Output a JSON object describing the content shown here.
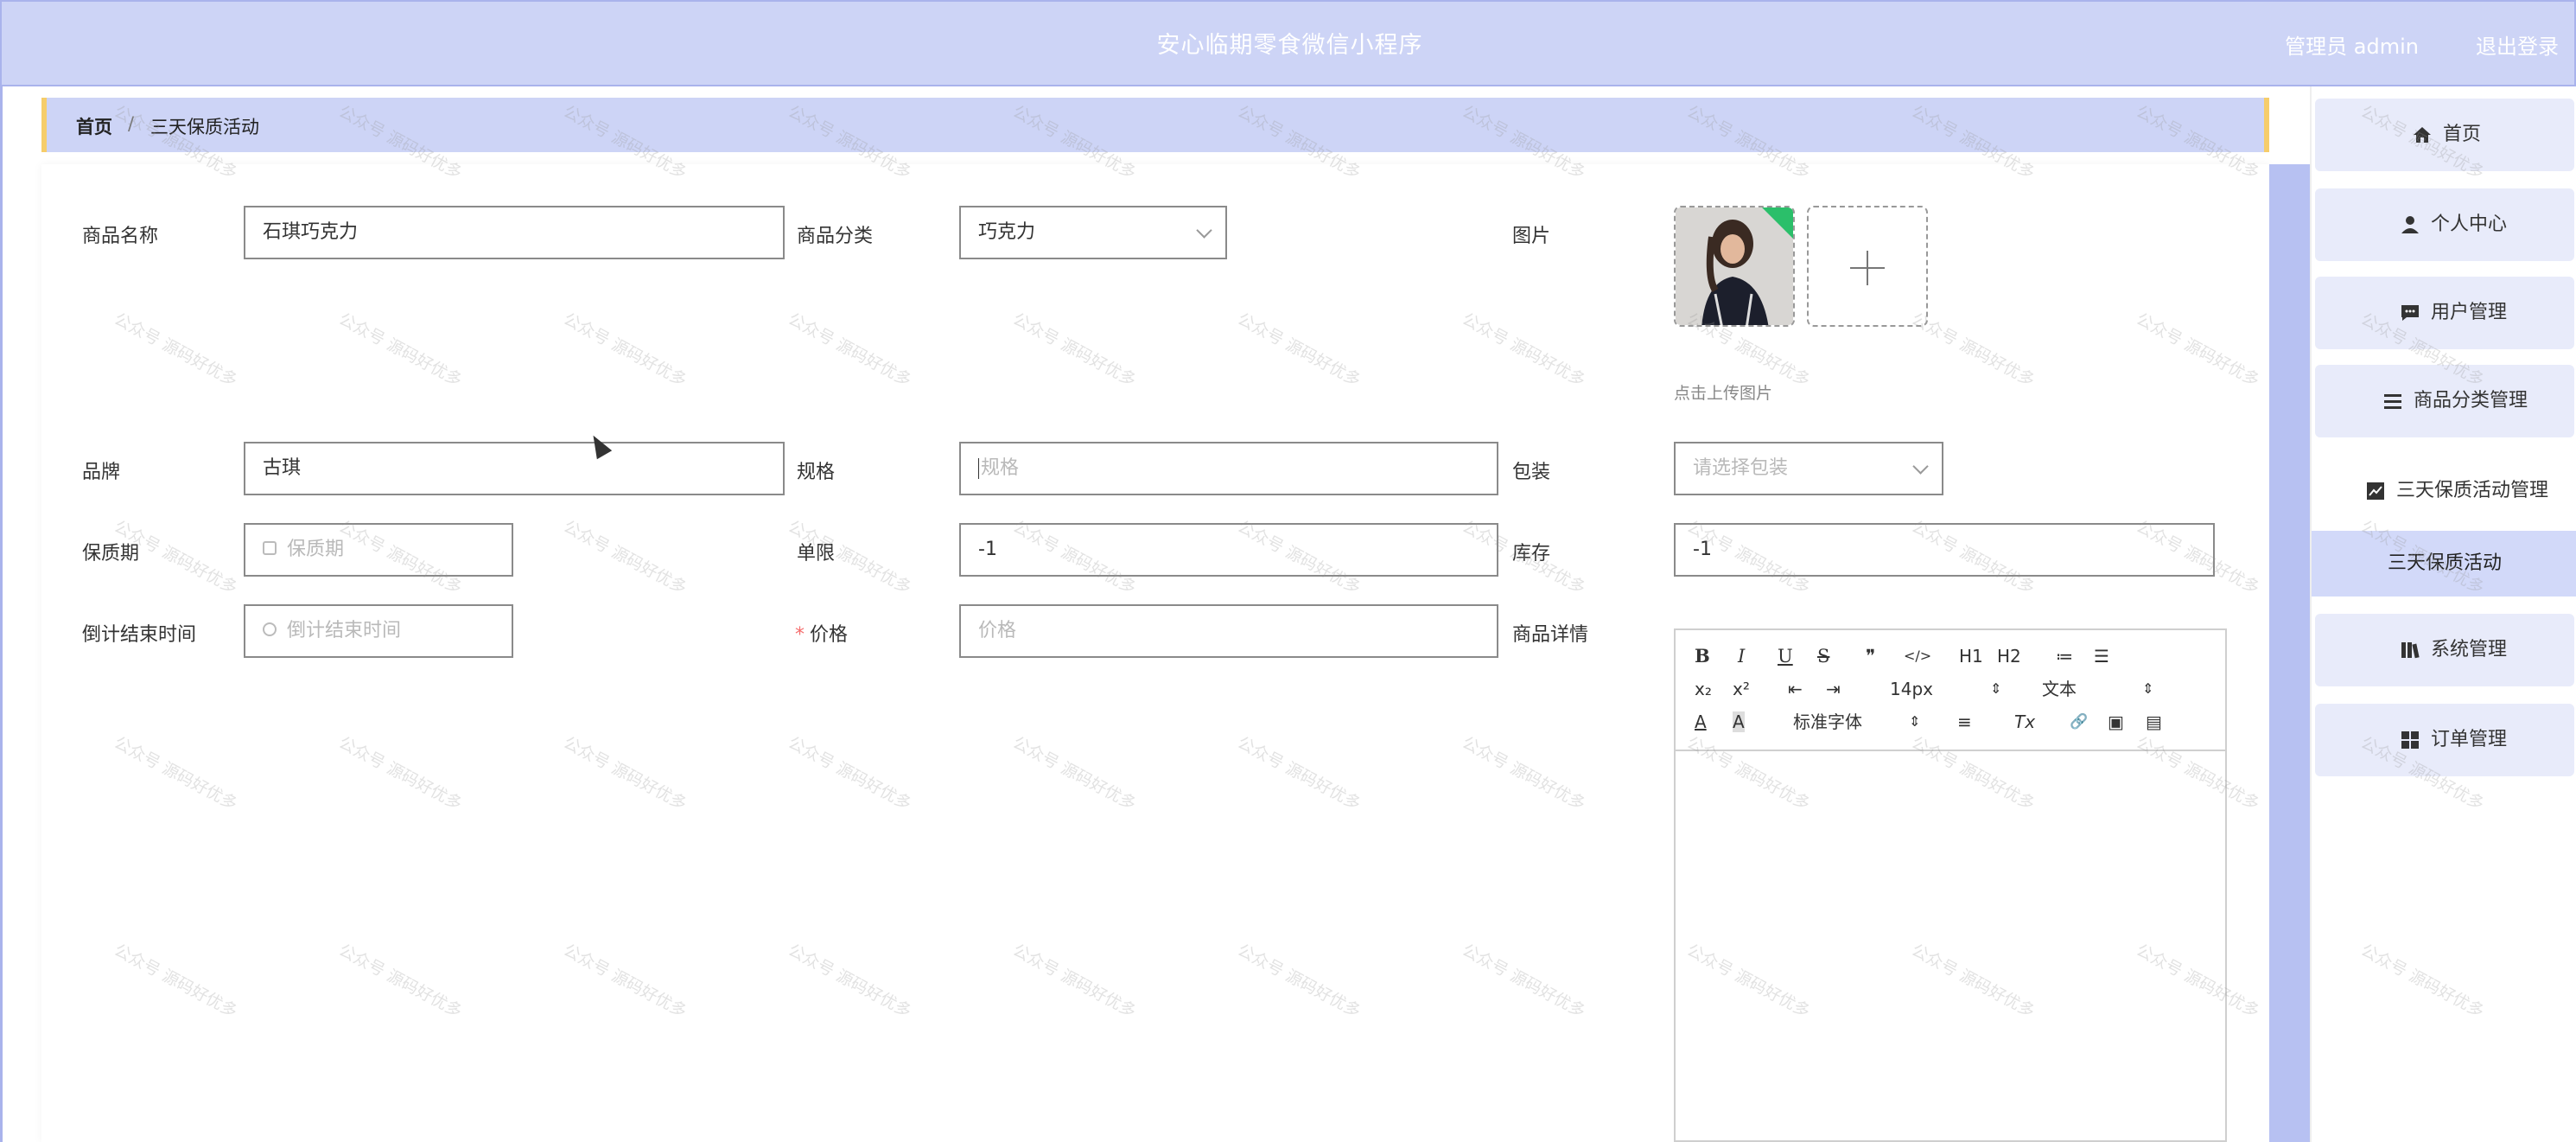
{
  "header": {
    "title": "安心临期零食微信小程序",
    "user_label": "管理员 admin",
    "logout_label": "退出登录"
  },
  "breadcrumb": {
    "home": "首页",
    "separator": "/",
    "current": "三天保质活动"
  },
  "sidebar": {
    "items": [
      {
        "label": "首页",
        "icon": "home-icon"
      },
      {
        "label": "个人中心",
        "icon": "user-icon"
      },
      {
        "label": "用户管理",
        "icon": "chat-icon"
      },
      {
        "label": "商品分类管理",
        "icon": "menu-lines-icon"
      },
      {
        "label": "三天保质活动管理",
        "icon": "chart-icon"
      },
      {
        "label": "系统管理",
        "icon": "library-icon"
      },
      {
        "label": "订单管理",
        "icon": "grid-icon"
      }
    ],
    "active_submenu": "三天保质活动"
  },
  "form": {
    "product_name": {
      "label": "商品名称",
      "value": "石琪巧克力"
    },
    "category": {
      "label": "商品分类",
      "value": "巧克力"
    },
    "image": {
      "label": "图片",
      "tip": "点击上传图片"
    },
    "brand": {
      "label": "品牌",
      "value": "古琪"
    },
    "spec": {
      "label": "规格",
      "placeholder": "规格"
    },
    "packaging": {
      "label": "包装",
      "placeholder": "请选择包装"
    },
    "shelf_life": {
      "label": "保质期",
      "placeholder": "保质期"
    },
    "limit": {
      "label": "单限",
      "value": "-1"
    },
    "stock": {
      "label": "库存",
      "value": "-1"
    },
    "countdown": {
      "label": "倒计结束时间",
      "placeholder": "倒计结束时间"
    },
    "price": {
      "label": "价格",
      "required_mark": "*",
      "placeholder": "价格"
    },
    "detail": {
      "label": "商品详情"
    }
  },
  "editor": {
    "buttons_row1": [
      "B",
      "I",
      "U",
      "S",
      "❞",
      "</>",
      "H1",
      "H2",
      "≔",
      "☰"
    ],
    "buttons_row2": [
      "x₂",
      "x²",
      "⇤",
      "⇥"
    ],
    "font_size": "14px",
    "header_select": "文本",
    "buttons_row3": [
      "A",
      "A"
    ],
    "font_family": "标准字体",
    "buttons_row3b": [
      "≡",
      "Tx",
      "🔗",
      "▣",
      "▤"
    ]
  },
  "watermark_text": "公众号 源码好优多"
}
